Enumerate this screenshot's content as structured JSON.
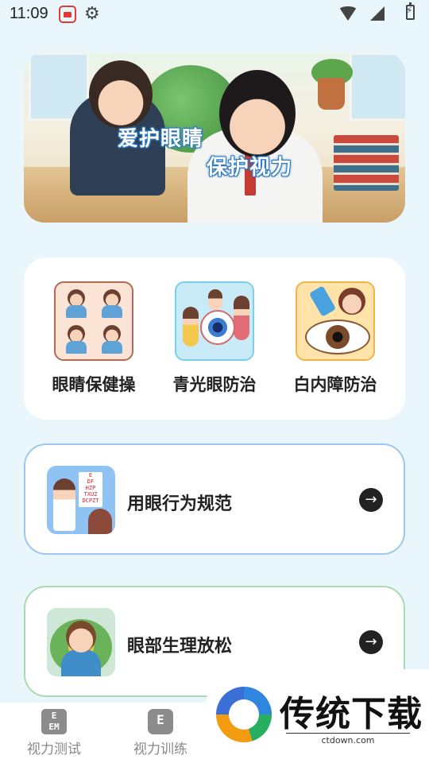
{
  "status_bar": {
    "time": "11:09"
  },
  "banner": {
    "slogan_line1": "爱护眼睛",
    "slogan_line2": "保护视力"
  },
  "categories": [
    {
      "label": "眼睛保健操",
      "icon": "eye-exercise-illustration"
    },
    {
      "label": "青光眼防治",
      "icon": "glaucoma-illustration"
    },
    {
      "label": "白内障防治",
      "icon": "cataract-illustration"
    }
  ],
  "list_cards": [
    {
      "label": "用眼行为规范",
      "icon": "eye-chart-doctor-illustration",
      "eye_chart": [
        "E",
        "DF",
        "HZP",
        "TXUZ",
        "DCPZT"
      ]
    },
    {
      "label": "眼部生理放松",
      "icon": "relaxing-child-illustration"
    }
  ],
  "bottom_nav": [
    {
      "label": "视力测试",
      "icon_text": "E\nEM"
    },
    {
      "label": "视力训练",
      "icon_text": "E"
    }
  ],
  "watermark": {
    "brand": "传统下载",
    "url": "ctdown.com"
  }
}
